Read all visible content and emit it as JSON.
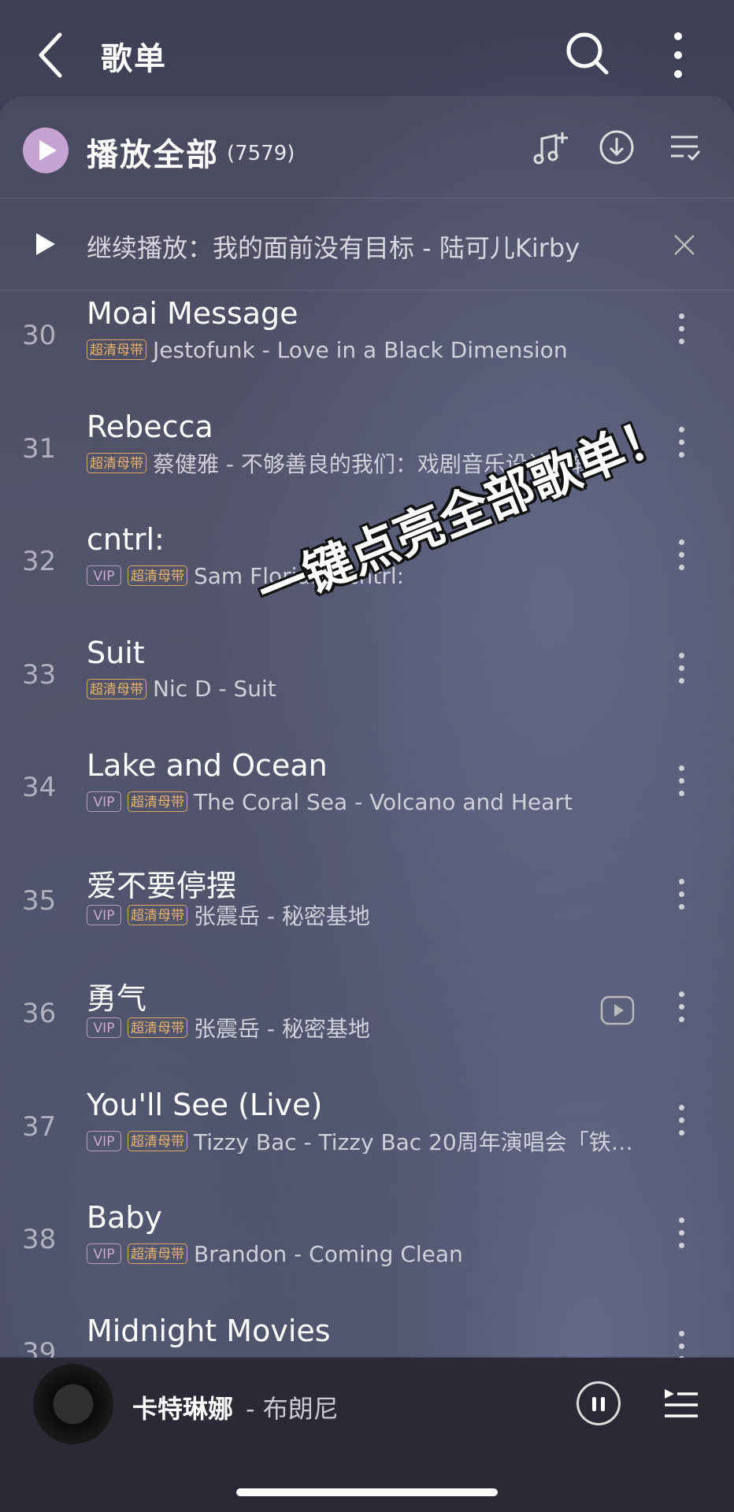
{
  "header": {
    "title": "歌单"
  },
  "play_all": {
    "label": "播放全部",
    "count": "(7579)"
  },
  "resume": {
    "text": "继续播放：我的面前没有目标 - 陆可儿Kirby"
  },
  "tags": {
    "vip": "VIP",
    "hq": "超清母带"
  },
  "songs": [
    {
      "num": "30",
      "title": "Moai Message",
      "vip": false,
      "hq": true,
      "artist": "Jestofunk - Love in a Black Dimension"
    },
    {
      "num": "31",
      "title": "Rebecca",
      "vip": false,
      "hq": true,
      "artist": "蔡健雅 - 不够善良的我们：戏剧音乐设计专辑"
    },
    {
      "num": "32",
      "title": "cntrl:",
      "vip": true,
      "hq": true,
      "artist": "Sam Florian - cntrl:"
    },
    {
      "num": "33",
      "title": "Suit",
      "vip": false,
      "hq": true,
      "artist": "Nic D - Suit"
    },
    {
      "num": "34",
      "title": "Lake and Ocean",
      "vip": true,
      "hq": true,
      "artist": "The Coral Sea - Volcano and Heart"
    },
    {
      "num": "35",
      "title": "爱不要停摆",
      "vip": true,
      "hq": true,
      "artist": "张震岳 - 秘密基地"
    },
    {
      "num": "36",
      "title": "勇气",
      "vip": true,
      "hq": true,
      "artist": "张震岳 - 秘密基地",
      "mv": true
    },
    {
      "num": "37",
      "title": "You'll See (Live)",
      "vip": true,
      "hq": true,
      "artist": "Tizzy Bac - Tizzy Bac 20周年演唱会「铁…"
    },
    {
      "num": "38",
      "title": "Baby",
      "vip": true,
      "hq": true,
      "artist": "Brandon - Coming Clean"
    },
    {
      "num": "39",
      "title": "Midnight Movies",
      "vip": false,
      "hq": false,
      "artist": ""
    }
  ],
  "overlay": {
    "text": "一键点亮全部歌单！"
  },
  "now_playing": {
    "title": "卡特琳娜",
    "artist": "- 布朗尼"
  },
  "colors": {
    "play_accent": "#c7a3d4",
    "vip": "#c9a9d4",
    "hq": "#e6b36c"
  }
}
